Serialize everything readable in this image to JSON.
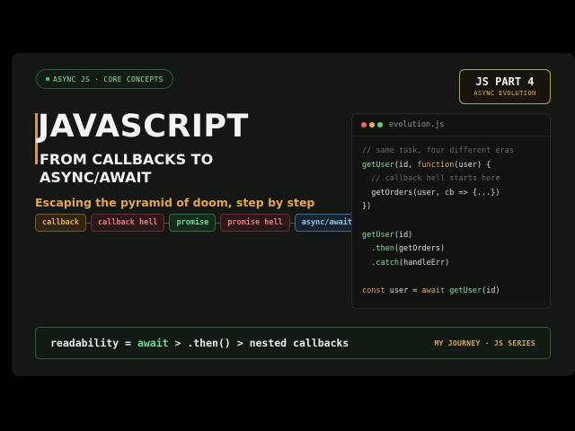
{
  "badge": {
    "label": "ASYNC JS · CORE CONCEPTS"
  },
  "part": {
    "title": "JS PART 4",
    "subtitle": "ASYNC EVOLUTION"
  },
  "heading": {
    "title": "JAVASCRIPT",
    "subtitle_line1": "FROM CALLBACKS TO",
    "subtitle_line2": "ASYNC/AWAIT",
    "tagline": "Escaping the pyramid of doom, step by step"
  },
  "pills": [
    "callback",
    "callback hell",
    "promise",
    "promise hell",
    "async/await"
  ],
  "code": {
    "file_name": "evolution.js",
    "lines": {
      "l1": "// same task, four different eras",
      "l2_fn": "getUser",
      "l2_a": "(id, ",
      "l2_kw": "function",
      "l2_b": "(user) {",
      "l3": "  // callback hell starts here",
      "l4": "  getOrders(user, cb => {...})",
      "l5": "})",
      "l6_fn": "getUser",
      "l6_b": "(id)",
      "l7_fn": "  .then",
      "l7_b": "(getOrders)",
      "l8_fn": "  .catch",
      "l8_b": "(handleErr)",
      "l9_kw": "const",
      "l9_a": " user = ",
      "l9_kw2": "await",
      "l9_sp": " ",
      "l9_fn": "getUser",
      "l9_b": "(id)"
    }
  },
  "footer": {
    "code_before": "readability = ",
    "code_await": "await",
    "code_after": " > .then() > nested callbacks",
    "tag": "MY JOURNEY · JS SERIES"
  },
  "colors": {
    "accent_gold": "#e2a646",
    "accent_green": "#6fd896",
    "background": "#141714"
  }
}
